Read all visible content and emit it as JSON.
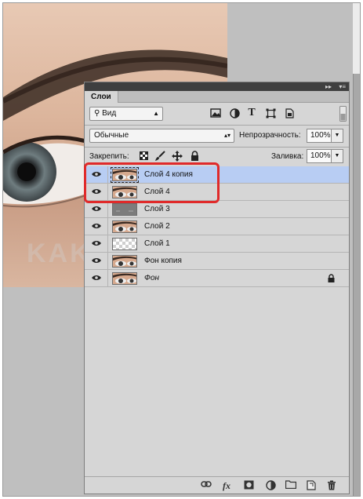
{
  "panel": {
    "tab_label": "Слои",
    "titlebar_controls": [
      "▸▸",
      "▾≡"
    ]
  },
  "filter": {
    "kind_label": "Вид",
    "icons": [
      "image-filter-icon",
      "adjustment-filter-icon",
      "type-filter-icon",
      "shape-filter-icon",
      "smart-object-filter-icon",
      "filter-toggle-icon"
    ]
  },
  "blend": {
    "mode_value": "Обычные",
    "opacity_label": "Непрозрачность:",
    "opacity_value": "100%"
  },
  "lock": {
    "label": "Закрепить:",
    "icons": [
      "lock-transparency-icon",
      "lock-brush-icon",
      "lock-position-icon",
      "lock-all-icon"
    ],
    "fill_label": "Заливка:",
    "fill_value": "100%"
  },
  "layers": [
    {
      "name": "Слой 4 копия",
      "visible": true,
      "selected": true,
      "thumb": "eye-photo",
      "italic": false,
      "locked": false
    },
    {
      "name": "Слой 4",
      "visible": true,
      "selected": false,
      "thumb": "eye-photo",
      "italic": false,
      "locked": false
    },
    {
      "name": "Слой 3",
      "visible": true,
      "selected": false,
      "thumb": "gray-fill",
      "italic": false,
      "locked": false
    },
    {
      "name": "Слой 2",
      "visible": true,
      "selected": false,
      "thumb": "eye-photo",
      "italic": false,
      "locked": false
    },
    {
      "name": "Слой 1",
      "visible": true,
      "selected": false,
      "thumb": "transparent",
      "italic": false,
      "locked": false
    },
    {
      "name": "Фон копия",
      "visible": true,
      "selected": false,
      "thumb": "eye-photo",
      "italic": false,
      "locked": false
    },
    {
      "name": "Фон",
      "visible": true,
      "selected": false,
      "thumb": "eye-photo",
      "italic": true,
      "locked": true
    }
  ],
  "bottom_bar": {
    "icons": [
      "link-layers-icon",
      "fx-icon",
      "layer-mask-icon",
      "adjustment-layer-icon",
      "new-group-icon",
      "new-layer-icon",
      "trash-icon"
    ],
    "fx_label": "fx"
  },
  "annotation": {
    "highlight_color": "#e02a2a"
  }
}
